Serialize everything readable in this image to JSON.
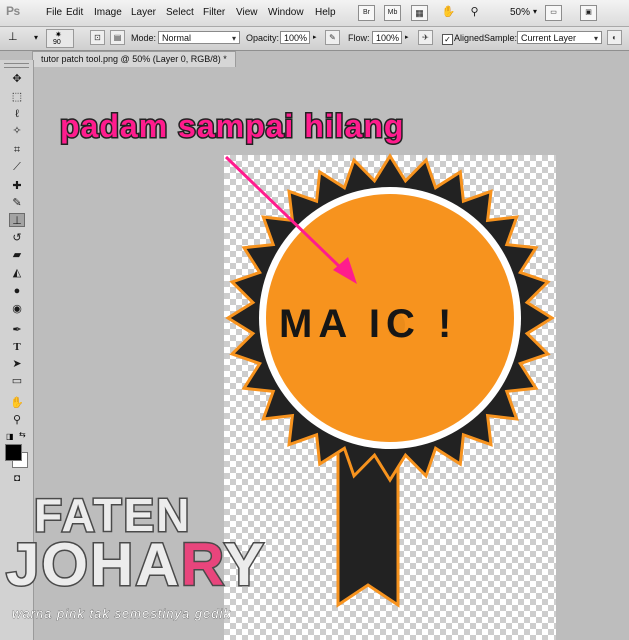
{
  "app": {
    "logo": "Ps"
  },
  "menu": [
    "File",
    "Edit",
    "Image",
    "Layer",
    "Select",
    "Filter",
    "View",
    "Window",
    "Help"
  ],
  "menu_buttons": [
    "Br",
    "Mb"
  ],
  "zoom": "50%",
  "options": {
    "brush_size": "90",
    "mode_label": "Mode:",
    "mode_value": "Normal",
    "opacity_label": "Opacity:",
    "opacity_value": "100%",
    "flow_label": "Flow:",
    "flow_value": "100%",
    "aligned_label": "Aligned",
    "aligned_checked": true,
    "sample_label": "Sample:",
    "sample_value": "Current Layer"
  },
  "document": {
    "tab_title": "tutor patch tool.png @ 50% (Layer 0, RGB/8) *"
  },
  "tools": [
    "move-icon",
    "marquee-icon",
    "lasso-icon",
    "quick-select-icon",
    "crop-icon",
    "eyedropper-icon",
    "healing-icon",
    "brush-icon",
    "clone-stamp-icon",
    "history-brush-icon",
    "eraser-icon",
    "paint-bucket-icon",
    "blur-icon",
    "dodge-icon",
    "pen-icon",
    "type-icon",
    "path-select-icon",
    "shape-icon",
    "hand-icon",
    "zoom-icon"
  ],
  "colors": {
    "foreground": "#000000",
    "background": "#ffffff",
    "accent": "#ff1c8d",
    "badge_orange": "#f7931e",
    "badge_dark": "#222222"
  },
  "canvas": {
    "annotation": "padam sampai hilang",
    "badge_text": "MA  IC !"
  },
  "watermark": {
    "line1": "FATEN",
    "line2_a": "JOHA",
    "line2_r": "R",
    "line2_b": "Y",
    "tagline": "warna pink tak semestinya gedik"
  }
}
